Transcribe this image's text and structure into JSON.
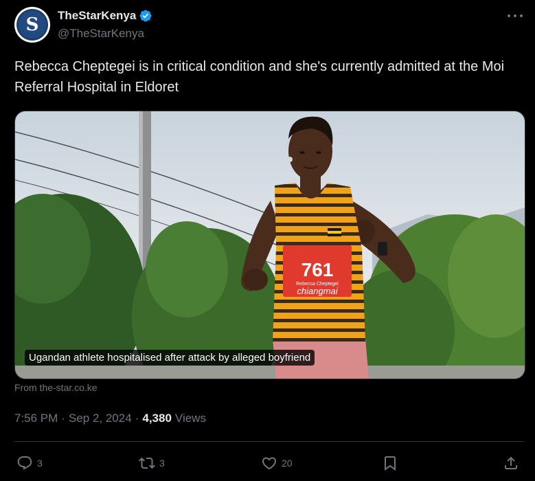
{
  "author": {
    "display_name": "TheStarKenya",
    "handle": "@TheStarKenya",
    "avatar_letter": "S",
    "verified": true,
    "verified_color": "#1d9bf0"
  },
  "tweet": {
    "text": "Rebecca Cheptegei is in critical condition and she's currently admitted at the Moi Referral Hospital in Eldoret"
  },
  "media": {
    "caption": "Ugandan athlete hospitalised after attack by alleged boyfriend",
    "bib_number": "761",
    "bib_name": "Rebecca Cheptegei",
    "bib_sponsor": "chiangmai",
    "source": "From the-star.co.ke"
  },
  "meta": {
    "time": "7:56 PM",
    "date": "Sep 2, 2024",
    "views_count": "4,380",
    "views_label": "Views"
  },
  "actions": {
    "reply_count": "3",
    "repost_count": "3",
    "like_count": "20"
  },
  "colors": {
    "background": "#000000",
    "text_primary": "#e7e9ea",
    "text_secondary": "#71767b",
    "accent": "#1d9bf0"
  }
}
